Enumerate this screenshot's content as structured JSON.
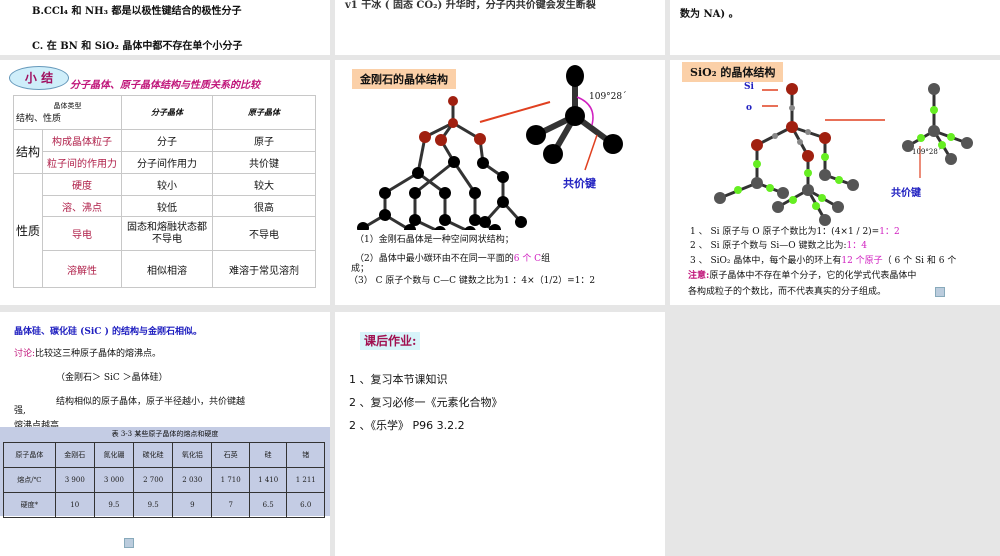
{
  "slide_q1": {
    "line_b": "B.CCl₄ 和 NH₃ 都是以极性键结合的极性分子",
    "line_c": "C. 在 BN 和 SiO₂ 晶体中都不存在单个小分子"
  },
  "slide_q2": {
    "line": "v1 干冰 ( 固态 CO₂) 升华时，分子内共价键会发生断裂"
  },
  "slide_q3": {
    "line": "数为 NA) 。"
  },
  "summary": {
    "badge": "小 结",
    "title": "分子晶体、原子晶体结构与性质关系的比较",
    "header": {
      "diag_top": "晶体类型",
      "diag_bottom": "结构、性质",
      "col1": "分子晶体",
      "col2": "原子晶体"
    },
    "group_structure": "结构",
    "group_property": "性质",
    "rows": [
      {
        "label": "构成晶体粒子",
        "mol": "分子",
        "atom": "原子"
      },
      {
        "label": "粒子间的作用力",
        "mol": "分子间作用力",
        "atom": "共价键"
      },
      {
        "label": "硬度",
        "mol": "较小",
        "atom": "较大"
      },
      {
        "label": "溶、沸点",
        "mol": "较低",
        "atom": "很高"
      },
      {
        "label": "导电",
        "mol": "固态和熔融状态都不导电",
        "atom": "不导电"
      },
      {
        "label": "溶解性",
        "mol": "相似相溶",
        "atom": "难溶于常见溶剂"
      }
    ]
  },
  "diamond": {
    "title": "金刚石的晶体结构",
    "angle": "109°28´",
    "bond_label": "共价键",
    "p1": "（1）金刚石晶体是一种空间网状结构；",
    "p2a": "（2）晶体中最小碳环由不在同一平面的",
    "p2b": "6 个 C",
    "p2c": "组",
    "p2d": "成；",
    "p3": "（3） C 原子个数与 C—C 键数之比为1 ：4×（1/2）=1：2"
  },
  "sio2": {
    "title": "SiO₂ 的晶体结构",
    "si": "Si",
    "o": "o",
    "angle": "109°28´",
    "bond_label": "共价键",
    "p1a": "1 、 Si 原子与 O 原子个数比为1：(4×1 / 2)=",
    "p1b": "1：2",
    "p2a": "2 、 Si 原子个数与 Si—O 键数之比为:",
    "p2b": "1：4",
    "p3a": "3 、 SiO₂ 晶体中，每个最小的环上有",
    "p3b": "12 个原子",
    "p3c": "（ 6 个 Si 和 6 个",
    "note_label": "注意:",
    "note1": "原子晶体中不存在单个分子，它的化学式代表晶体中",
    "note2": "各构成粒子的个数比，而不代表真实的分子组成。"
  },
  "similar": {
    "l1": "晶体硅、碳化硅 (SiC ) 的结构与金刚石相似。",
    "disc_label": "讨论:",
    "disc": "比较这三种原子晶体的熔沸点。",
    "order": "（金刚石＞  SiC ＞晶体硅）",
    "l3": "结构相似的原子晶体，原子半径越小，共价键越",
    "l3b": "强,",
    "l4": "熔沸点越高",
    "table_caption": "表 3-3  某些原子晶体的熔点和硬度",
    "table": [
      [
        "原子晶体",
        "金刚石",
        "氮化硼",
        "碳化硅",
        "氧化铝",
        "石英",
        "硅",
        "锗"
      ],
      [
        "熔点/℃",
        "3 900",
        "3 000",
        "2 700",
        "2 030",
        "1 710",
        "1 410",
        "1 211"
      ],
      [
        "硬度*",
        "10",
        "9.5",
        "9.5",
        "9",
        "7",
        "6.5",
        "6.0"
      ]
    ]
  },
  "homework": {
    "title": "课后作业:",
    "items": [
      "1 、复习本节课知识",
      "2 、复习必修一《元素化合物》",
      "2 、《乐学》 P96      3.2.2"
    ]
  }
}
